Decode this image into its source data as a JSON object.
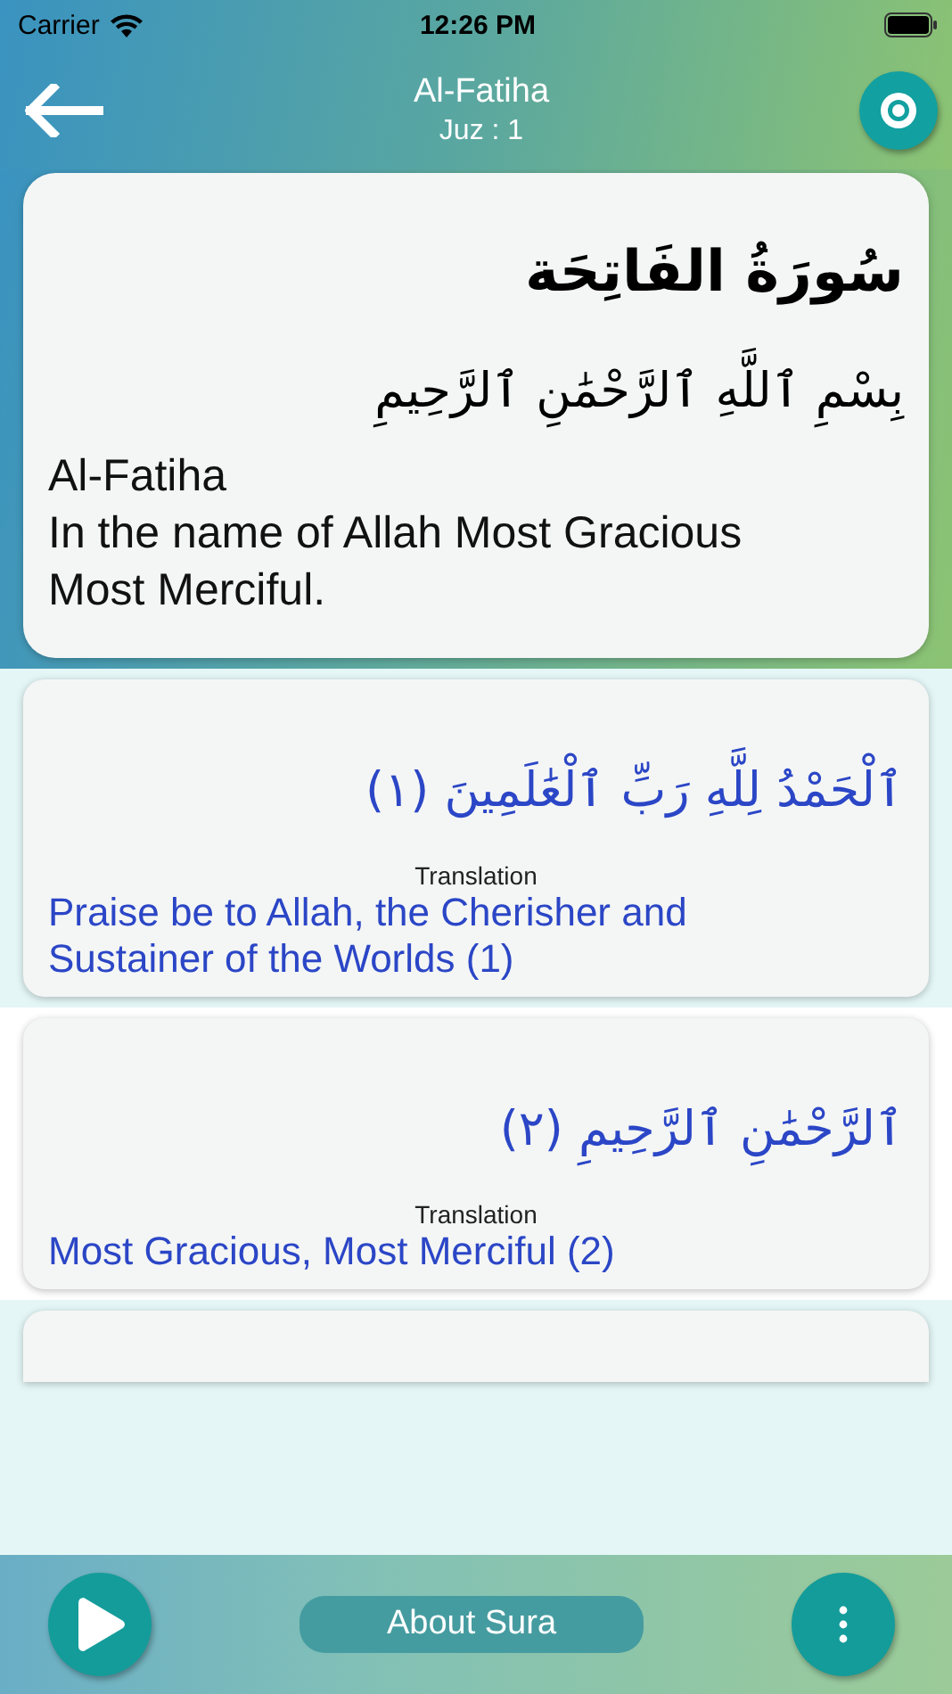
{
  "status_bar": {
    "carrier": "Carrier",
    "time": "12:26 PM"
  },
  "header": {
    "title": "Al-Fatiha",
    "subtitle": "Juz : 1"
  },
  "intro": {
    "sura_name_arabic": "سُورَةُ الفَاتِحَة",
    "bismillah": "بِسْمِ ٱللَّهِ ٱلرَّحْمَٰنِ ٱلرَّحِيمِ",
    "sura_name": "Al-Fatiha",
    "bismillah_translation": "In the name of Allah Most Gracious Most Merciful."
  },
  "verses": [
    {
      "arabic": "ٱلْحَمْدُ لِلَّهِ رَبِّ ٱلْعَٰلَمِينَ (١)",
      "label": "Translation",
      "translation": "Praise be to Allah, the Cherisher and Sustainer of the Worlds (1)"
    },
    {
      "arabic": "ٱلرَّحْمَٰنِ ٱلرَّحِيمِ (٢)",
      "label": "Translation",
      "translation": "Most Gracious, Most Merciful (2)"
    }
  ],
  "bottom_bar": {
    "about_button": "About Sura"
  }
}
